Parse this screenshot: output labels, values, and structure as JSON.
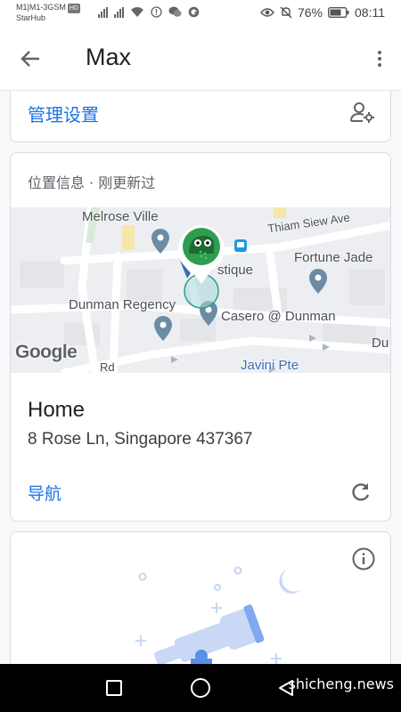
{
  "status_bar": {
    "carrier_line1": "M1|M1-3GSM",
    "carrier_badge": "HD",
    "carrier_line2": "StarHub",
    "battery": "76%",
    "time": "08:11"
  },
  "app_bar": {
    "title": "Max"
  },
  "manage_card": {
    "label": "管理设置"
  },
  "location_card": {
    "header": "位置信息 · 刚更新过",
    "map": {
      "labels": [
        "Melrose Ville",
        "Thiam Siew Ave",
        "stique",
        "Fortune Jade",
        "Dunman Regency",
        "Casero @ Dunman",
        "Du",
        "Rd",
        "Javini Pte"
      ],
      "logo": "Google"
    },
    "place_name": "Home",
    "address": "8 Rose Ln, Singapore 437367",
    "navigate_label": "导航"
  },
  "nav_bar": {
    "watermark": "shicheng.news"
  },
  "colors": {
    "accent": "#1a73e8",
    "avatar_bg": "#2e9d4f",
    "card_border": "#dadce0"
  },
  "icons": [
    "back-arrow-icon",
    "more-vert-icon",
    "manage-accounts-icon",
    "map-pin-icon",
    "transit-icon",
    "refresh-icon",
    "info-icon",
    "telescope-illustration"
  ]
}
